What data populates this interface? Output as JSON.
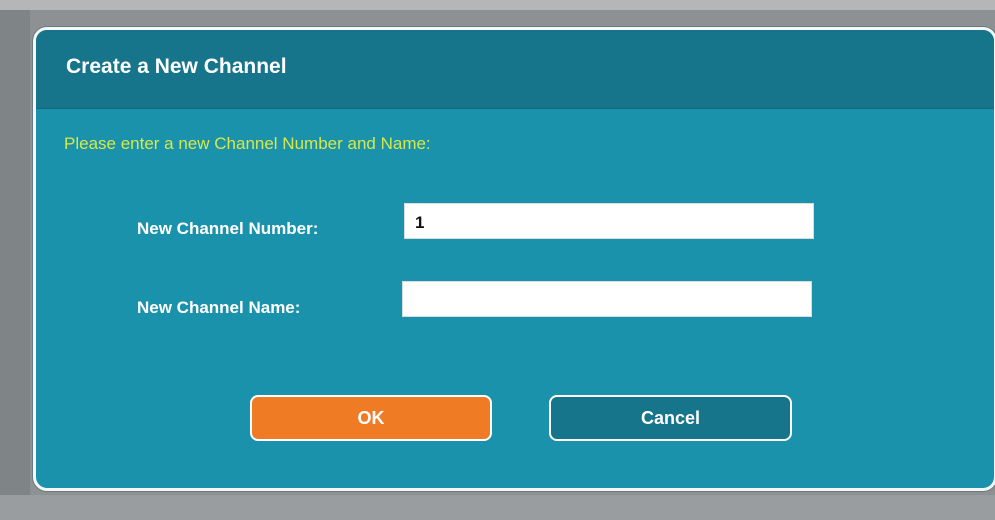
{
  "dialog": {
    "title": "Create a New Channel",
    "prompt": "Please enter a new Channel Number and Name:",
    "fields": {
      "number_label": "New Channel Number:",
      "number_value": "1",
      "name_label": "New Channel Name:",
      "name_value": ""
    },
    "buttons": {
      "ok_label": "OK",
      "cancel_label": "Cancel"
    }
  },
  "colors": {
    "dialog_background": "#1b92ab",
    "titlebar": "#16758a",
    "prompt_text": "#d6e84a",
    "ok_button": "#ef7b25",
    "cancel_button": "#16758a"
  }
}
